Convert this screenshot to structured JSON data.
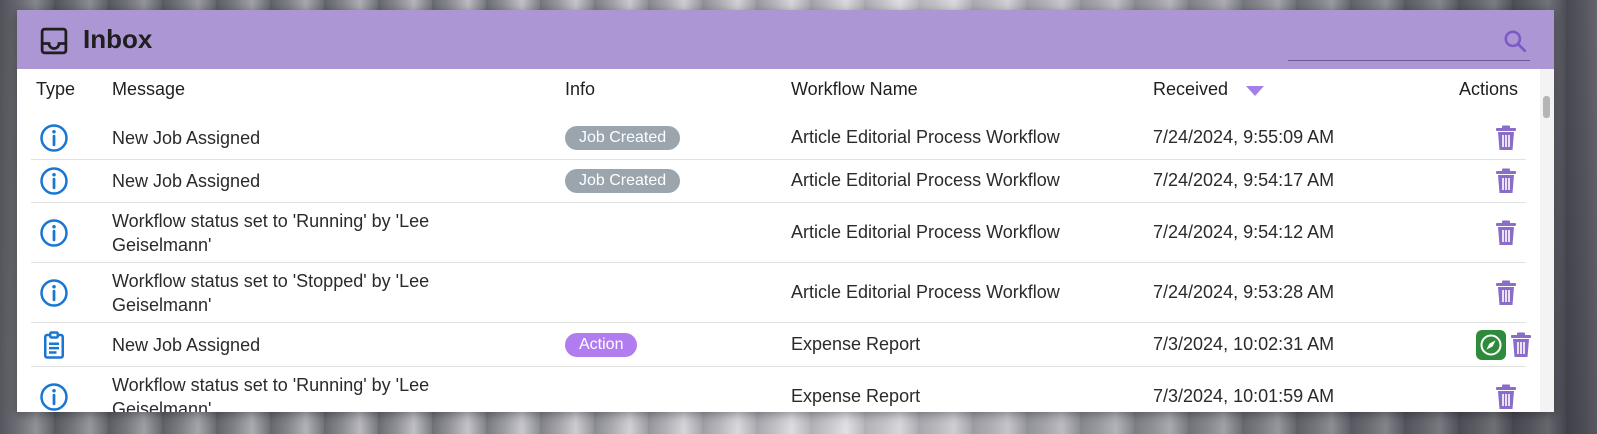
{
  "header": {
    "title": "Inbox",
    "icon": "inbox-icon",
    "search": {
      "placeholder": "",
      "value": "",
      "icon": "search-icon"
    },
    "accent_color": "#9b7fd4"
  },
  "columns": {
    "type": "Type",
    "message": "Message",
    "info": "Info",
    "workflow": "Workflow Name",
    "received": "Received",
    "actions": "Actions",
    "sorted_by": "Received",
    "sort_direction": "descending"
  },
  "rows": [
    {
      "type_icon": "info-circle-icon",
      "message": "New Job Assigned",
      "info": "Job Created",
      "info_color": "#9aa5ad",
      "workflow": "Article Editorial Process Workflow",
      "received": "7/24/2024, 9:55:09 AM",
      "actions": [
        "delete"
      ]
    },
    {
      "type_icon": "info-circle-icon",
      "message": "New Job Assigned",
      "info": "Job Created",
      "info_color": "#9aa5ad",
      "workflow": "Article Editorial Process Workflow",
      "received": "7/24/2024, 9:54:17 AM",
      "actions": [
        "delete"
      ]
    },
    {
      "type_icon": "info-circle-icon",
      "message": "Workflow status set to 'Running' by 'Lee Geiselmann'",
      "info": "",
      "workflow": "Article Editorial Process Workflow",
      "received": "7/24/2024, 9:54:12 AM",
      "actions": [
        "delete"
      ]
    },
    {
      "type_icon": "info-circle-icon",
      "message": "Workflow status set to 'Stopped' by 'Lee Geiselmann'",
      "info": "",
      "workflow": "Article Editorial Process Workflow",
      "received": "7/24/2024, 9:53:28 AM",
      "actions": [
        "delete"
      ]
    },
    {
      "type_icon": "clipboard-icon",
      "message": "New Job Assigned",
      "info": "Action",
      "info_color": "#b07cf0",
      "workflow": "Expense Report",
      "received": "7/3/2024, 10:02:31 AM",
      "actions": [
        "navigate",
        "delete"
      ]
    },
    {
      "type_icon": "info-circle-icon",
      "message": "Workflow status set to 'Running' by 'Lee Geiselmann'",
      "info": "",
      "workflow": "Expense Report",
      "received": "7/3/2024, 10:01:59 AM",
      "actions": [
        "delete"
      ]
    }
  ],
  "colors": {
    "icon_blue": "#1976d2",
    "trash_purple": "#8a6cc9",
    "navigate_green": "#2e8b3c"
  }
}
